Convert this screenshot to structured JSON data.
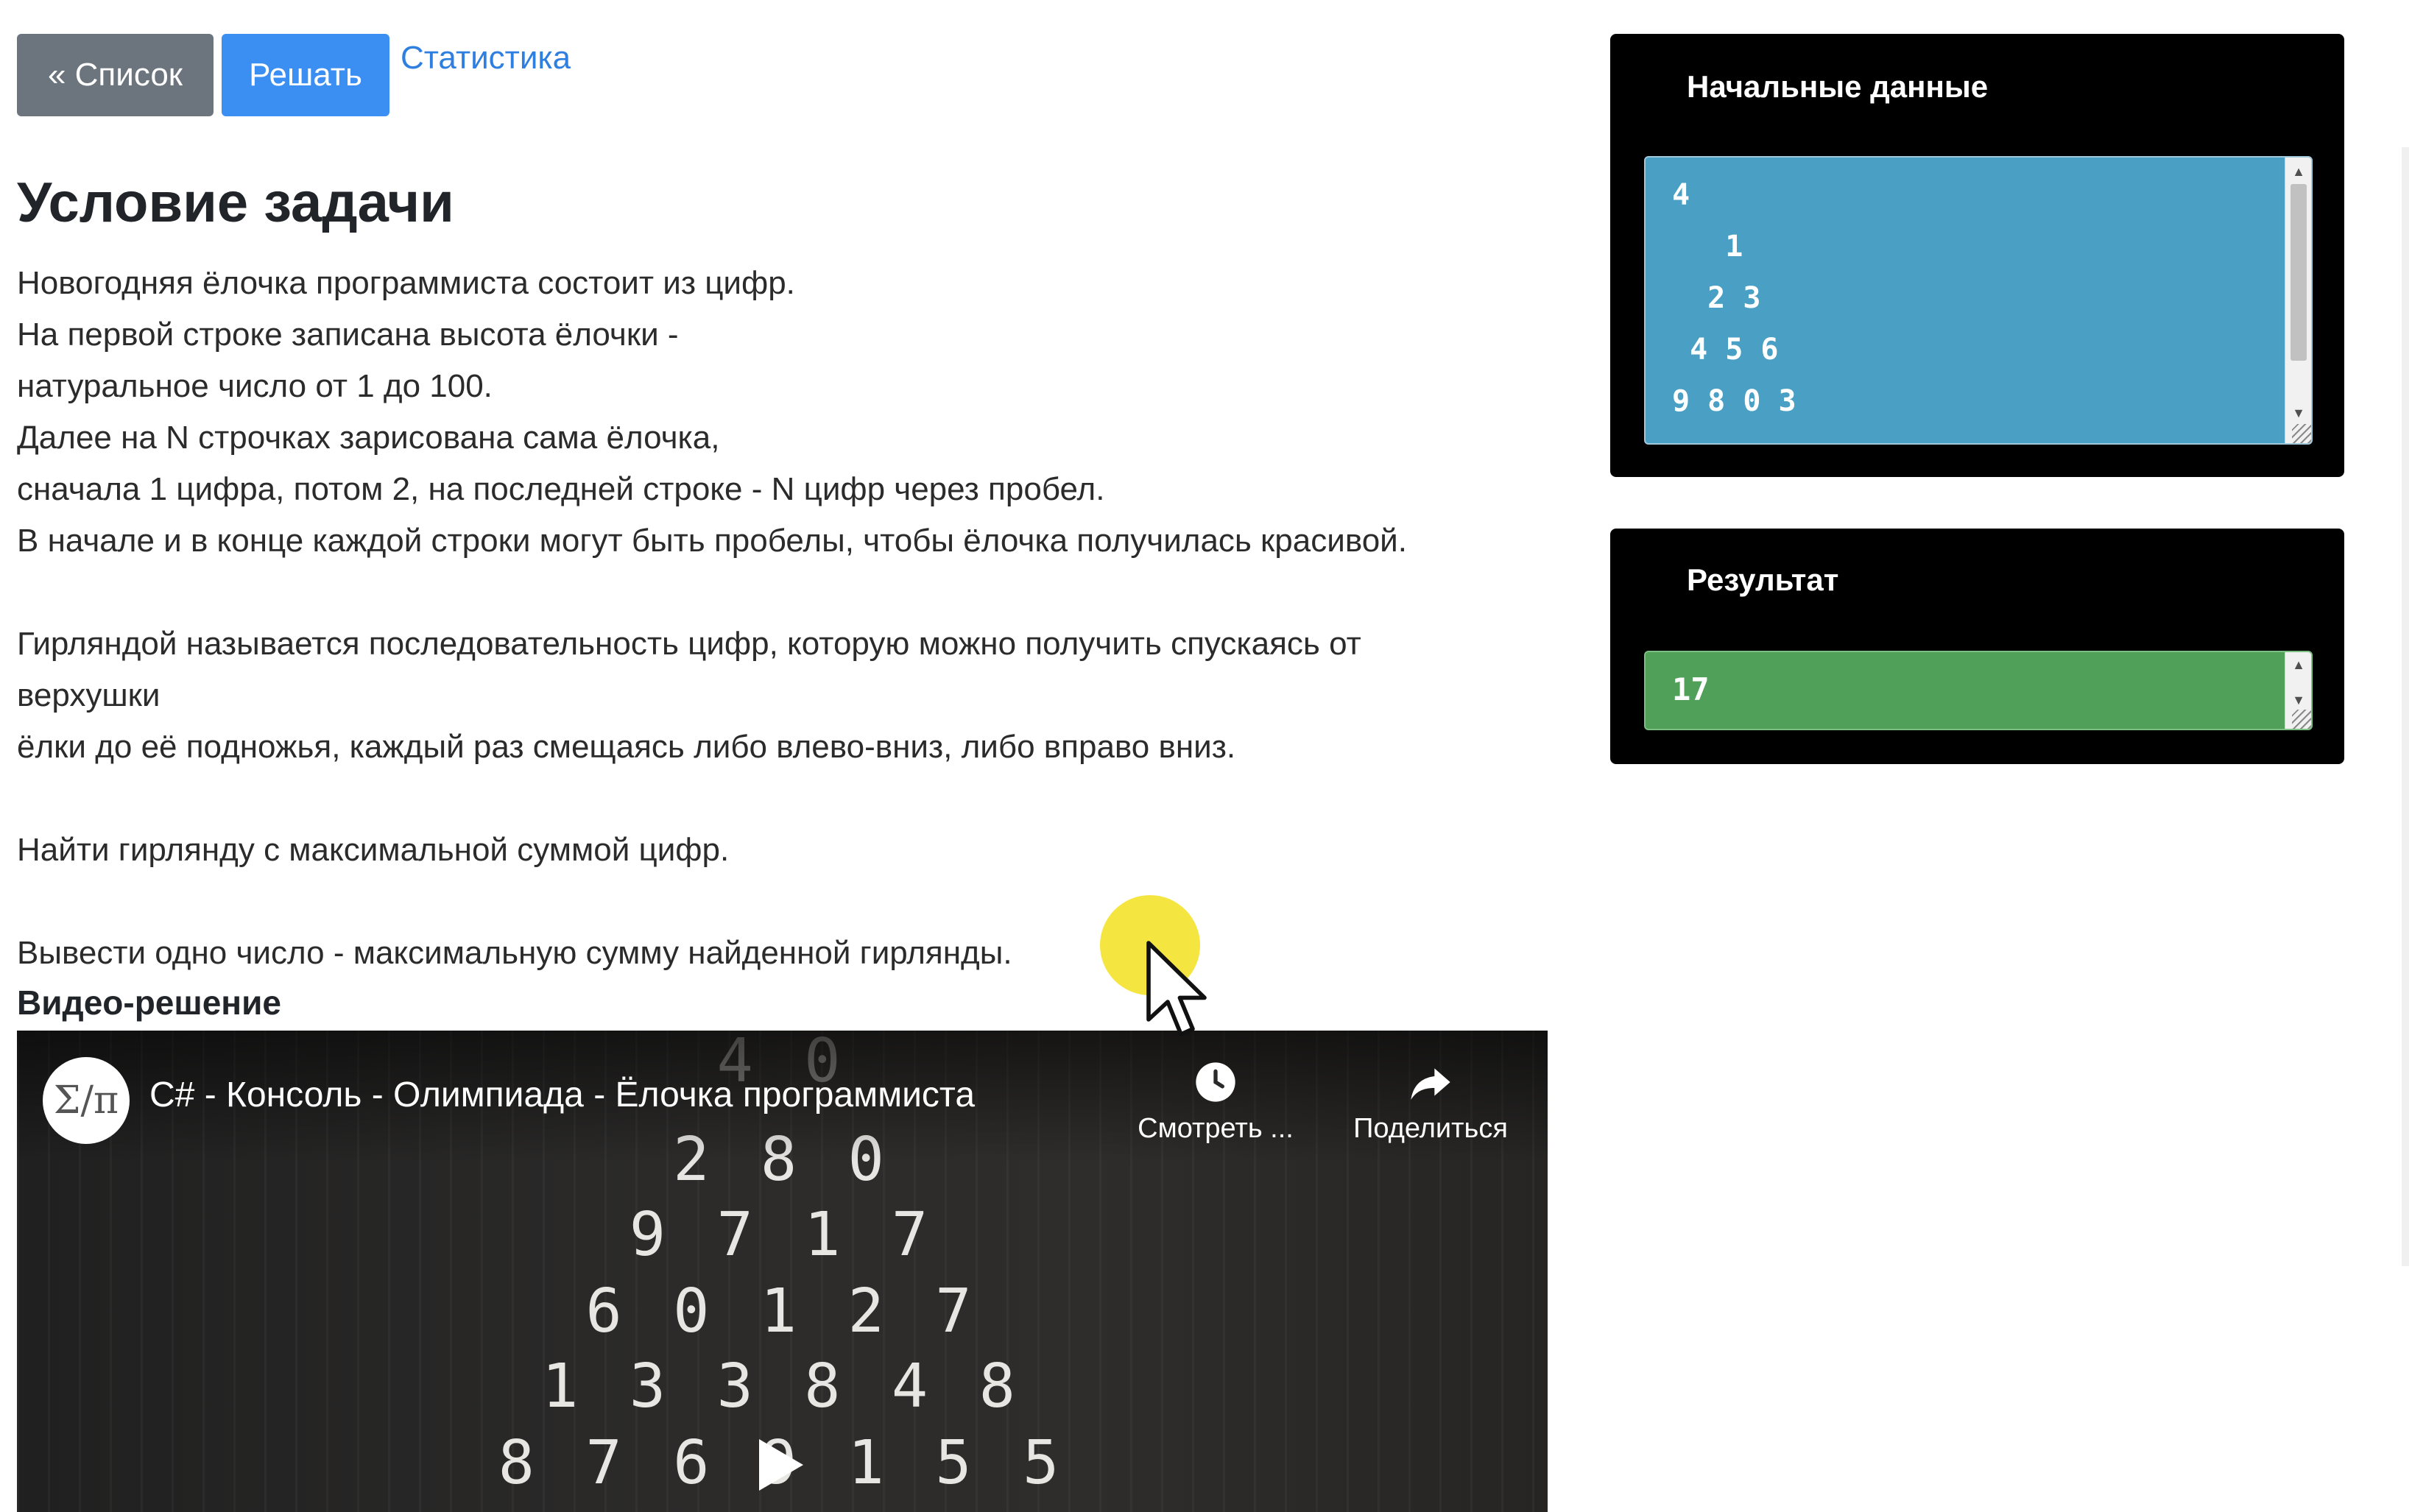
{
  "toolbar": {
    "list_label": "« Список",
    "solve_label": "Решать",
    "stats_label": "Статистика"
  },
  "task": {
    "title": "Условие задачи",
    "lines": [
      "Новогодняя ёлочка программиста состоит из цифр.",
      "На первой строке записана высота ёлочки -",
      "натуральное число от 1 до 100.",
      "Далее на N строчках зарисована сама ёлочка,",
      "сначала 1 цифра, потом 2, на последней строке - N цифр через пробел.",
      "В начале и в конце каждой строки могут быть пробелы, чтобы ёлочка получилась красивой.",
      "Гирляндой называется последовательность цифр, которую можно получить спускаясь от",
      "верхушки",
      "ёлки до её подножья, каждый раз смещаясь либо влево-вниз, либо вправо вниз.",
      "Найти гирлянду с максимальной суммой цифр.",
      "Вывести одно число - максимальную сумму найденной гирлянды."
    ],
    "video_label": "Видео-решение"
  },
  "video": {
    "channel_avatar_text": "Σ/π",
    "title": "C# - Консоль - Олимпиада - Ёлочка программиста",
    "watch_later_label": "Смотреть ...",
    "share_label": "Поделиться",
    "frame_rows": [
      "4 0",
      "2 8 0",
      "9 7 1 7",
      "6 0 1 2 7",
      "1 3 3 8 4 8",
      "8 7 6 9 1 5 5"
    ],
    "icons": {
      "watch_later": "clock-icon",
      "share": "share-arrow-icon",
      "play": "play-icon"
    }
  },
  "input_panel": {
    "header": "Начальные данные",
    "lines": [
      "4",
      "   1",
      "  2 3",
      " 4 5 6",
      "9 8 0 3"
    ]
  },
  "result_panel": {
    "header": "Результат",
    "value": "17"
  },
  "colors": {
    "list_button": "#6c757d",
    "solve_button": "#3b8ff3",
    "link": "#2f7fe0",
    "input_box": "#4aa0c4",
    "result_box": "#50a05a",
    "panel": "#000000",
    "cursor_highlight": "#f4e22c"
  }
}
